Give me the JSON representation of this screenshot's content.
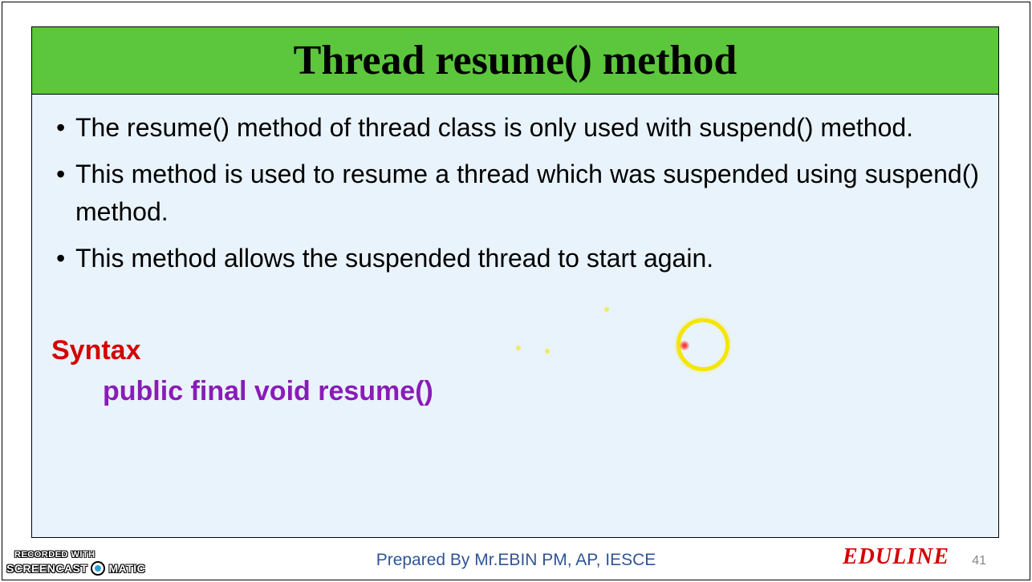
{
  "slide": {
    "title": "Thread resume() method",
    "bullets": [
      "The resume() method of thread class is only used with suspend() method.",
      "This method is used to resume a thread which was suspended using suspend() method.",
      "This method allows the suspended thread to start again."
    ],
    "syntax_label": "Syntax",
    "syntax_code": "public final void resume()"
  },
  "footer": {
    "prepared_by": "Prepared By Mr.EBIN PM, AP, IESCE",
    "brand": "EDULINE",
    "page": "41"
  },
  "watermark": {
    "line1": "RECORDED WITH",
    "part1": "SCREENCAST",
    "part2": "MATIC"
  }
}
